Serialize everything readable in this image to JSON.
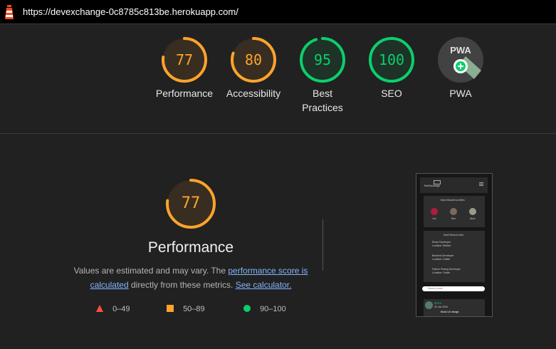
{
  "browser": {
    "url": "https://devexchange-0c8785c813be.herokuapp.com/"
  },
  "colors": {
    "orange": "#ffa32c",
    "green": "#0cce6b",
    "red": "#ff4e42",
    "link": "#82b6ff"
  },
  "gauges": [
    {
      "score": "77",
      "label": "Performance",
      "fraction": 0.77,
      "status": "average"
    },
    {
      "score": "80",
      "label": "Accessibility",
      "fraction": 0.8,
      "status": "average"
    },
    {
      "score": "95",
      "label": "Best Practices",
      "fraction": 0.95,
      "status": "pass"
    },
    {
      "score": "100",
      "label": "SEO",
      "fraction": 1.0,
      "status": "pass"
    },
    {
      "score": "PWA",
      "label": "PWA",
      "status": "badge"
    }
  ],
  "performance": {
    "score": "77",
    "fraction": 0.77,
    "title": "Performance",
    "desc_prefix": "Values are estimated and may vary. The ",
    "link_score": "performance score is calculated",
    "desc_mid": " directly from these metrics. ",
    "link_calc": "See calculator.",
    "legend": [
      {
        "range": "0–49",
        "shape": "triangle"
      },
      {
        "range": "50–89",
        "shape": "square"
      },
      {
        "range": "90–100",
        "shape": "circle"
      }
    ]
  },
  "thumbnail": {
    "brand": "DevExchange",
    "followed_title": "Most followed profiles",
    "profiles": [
      "Joe",
      "Ben",
      "Alice"
    ],
    "jobs_title": "Most Recent Jobs",
    "jobs": [
      {
        "title": "React Developer",
        "location": "Location: Belfast"
      },
      {
        "title": "Backend Developer",
        "location": "Location: Dublin"
      },
      {
        "title": "Python Testing Developer",
        "location": "Location: Dublin"
      }
    ],
    "search_placeholder": "Search posts",
    "post_user": "BE'EA",
    "post_date": "30 Jan 2024",
    "post_text": "Mock UX design"
  }
}
